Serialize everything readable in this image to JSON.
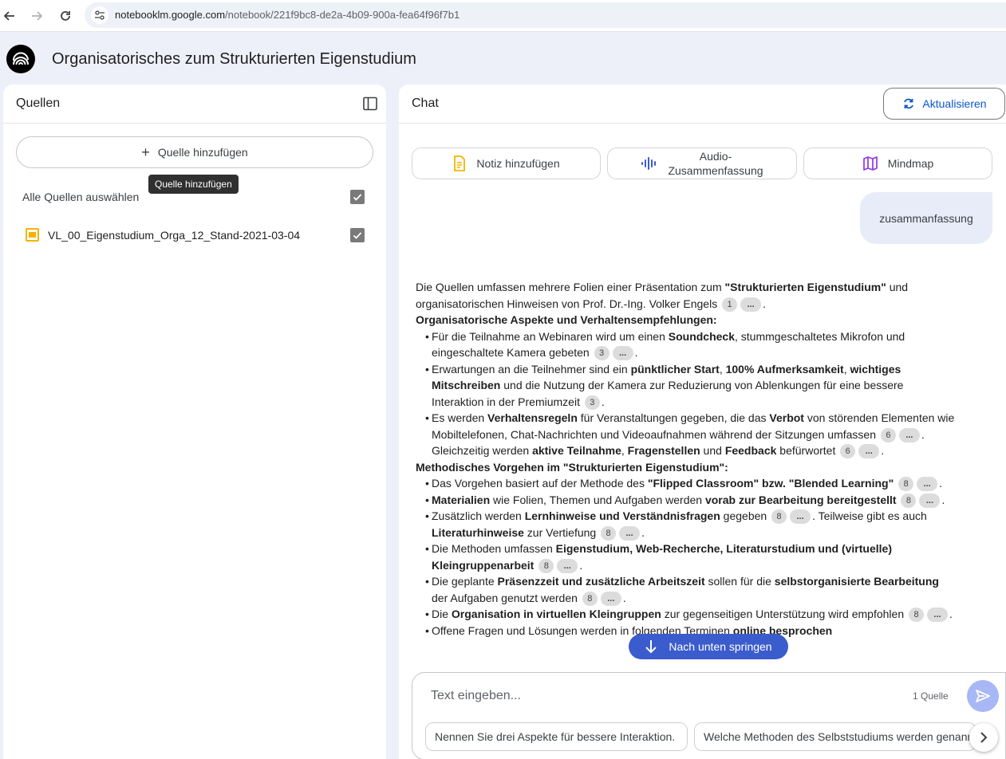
{
  "browser": {
    "url_host": "notebooklm.google.com",
    "url_path": "/notebook/221f9bc8-de2a-4b09-900a-fea64f96f7b1"
  },
  "app": {
    "title": "Organisatorisches zum Strukturierten Eigenstudium"
  },
  "sources": {
    "title": "Quellen",
    "add_label": "Quelle hinzufügen",
    "tooltip": "Quelle hinzufügen",
    "select_all_label": "Alle Quellen auswählen",
    "items": [
      {
        "label": "VL_00_Eigenstudium_Orga_12_Stand-2021-03-04",
        "checked": true
      }
    ]
  },
  "chat": {
    "title": "Chat",
    "refresh_label": "Aktualisieren",
    "actions": {
      "note_label": "Notiz hinzufügen",
      "audio_line1": "Audio-",
      "audio_line2": "Zusammenfassung",
      "mindmap_label": "Mindmap"
    },
    "user_message": "zusammanfassung",
    "answer": {
      "intro": {
        "t1": "Die Quellen umfassen mehrere Folien einer Präsentation zum ",
        "b1": "\"Strukturierten Eigenstudium\"",
        "t2": " und organisatorischen Hinweisen von Prof. Dr.-Ing. Volker Engels",
        "c1": "1",
        "c2": "...",
        "t3": "."
      },
      "heading1": "Organisatorische Aspekte und Verhaltensempfehlungen:",
      "b1": {
        "t1": "Für die Teilnahme an Webinaren wird um einen ",
        "s1": "Soundcheck",
        "t2": ", stummgeschaltetes Mikrofon und eingeschaltete Kamera gebeten",
        "c1": "3",
        "c2": "...",
        "t3": "."
      },
      "b2": {
        "t1": "Erwartungen an die Teilnehmer sind ein ",
        "s1": "pünktlicher Start",
        "t2": ", ",
        "s2": "100% Aufmerksamkeit",
        "t3": ", ",
        "s3": "wichtiges Mitschreiben",
        "t4": " und die Nutzung der Kamera zur Reduzierung von Ablenkungen für eine bessere Interaktion in der Premiumzeit",
        "c1": "3",
        "t5": "."
      },
      "b3": {
        "t1": "Es werden ",
        "s1": "Verhaltensregeln",
        "t2": " für Veranstaltungen gegeben, die das ",
        "s2": "Verbot",
        "t3": " von störenden Elementen wie Mobiltelefonen, Chat-Nachrichten und Videoaufnahmen während der Sitzungen umfassen",
        "c1": "6",
        "c2": "...",
        "t4": ". Gleichzeitig werden ",
        "s3": "aktive Teilnahme",
        "t5": ", ",
        "s4": "Fragenstellen",
        "t6": " und ",
        "s5": "Feedback",
        "t7": " befürwortet",
        "c3": "6",
        "c4": "...",
        "t8": "."
      },
      "heading2": "Methodisches Vorgehen im \"Strukturierten Eigenstudium\":",
      "b4": {
        "t1": "Das Vorgehen basiert auf der Methode des ",
        "s1": "\"Flipped Classroom\" bzw. \"Blended Learning\"",
        "c1": "8",
        "c2": "...",
        "t2": "."
      },
      "b5": {
        "s1": "Materialien",
        "t1": " wie Folien, Themen und Aufgaben werden ",
        "s2": "vorab zur Bearbeitung bereitgestellt",
        "c1": "8",
        "c2": "...",
        "t2": "."
      },
      "b6": {
        "t1": "Zusätzlich werden ",
        "s1": "Lernhinweise und Verständnisfragen",
        "t2": " gegeben",
        "c1": "8",
        "c2": "...",
        "t3": ". Teilweise gibt es auch ",
        "s2": "Literaturhinweise",
        "t4": " zur Vertiefung",
        "c3": "8",
        "c4": "...",
        "t5": "."
      },
      "b7": {
        "t1": "Die Methoden umfassen ",
        "s1": "Eigenstudium, Web-Recherche, Literaturstudium und (virtuelle) Kleingruppenarbeit",
        "c1": "8",
        "c2": "...",
        "t2": "."
      },
      "b8": {
        "t1": "Die geplante ",
        "s1": "Präsenzzeit und zusätzliche Arbeitszeit",
        "t2": " sollen für die ",
        "s2": "selbstorganisierte Bearbeitung",
        "t3": " der Aufgaben genutzt werden",
        "c1": "8",
        "c2": "...",
        "t4": "."
      },
      "b9": {
        "t1": "Die ",
        "s1": "Organisation in virtuellen Kleingruppen",
        "t2": " zur gegenseitigen Unterstützung wird empfohlen",
        "c1": "8",
        "c2": "...",
        "t3": "."
      },
      "b10": {
        "t1": "Offene Fragen und Lösungen werden in folgenden Terminen ",
        "s1": "online besprochen"
      }
    },
    "jump_label": "Nach unten springen",
    "composer": {
      "placeholder": "Text eingeben...",
      "source_count": "1 Quelle"
    },
    "suggestions": [
      "Nennen Sie drei Aspekte für bessere Interaktion.",
      "Welche Methoden des Selbststudiums werden genannt?"
    ]
  },
  "colors": {
    "accent": "#0b57d0",
    "jump_button": "#3b5ccc",
    "send_button": "#a8b7f6",
    "page_background": "#eef0f9",
    "source_icon": "#f4b400"
  }
}
